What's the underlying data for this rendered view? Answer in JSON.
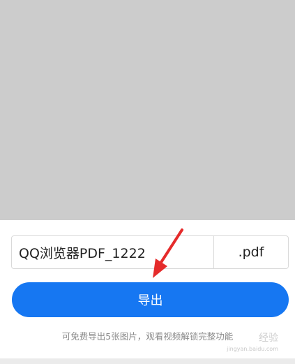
{
  "export_form": {
    "filename_value": "QQ浏览器PDF_1222",
    "extension": ".pdf",
    "export_label": "导出",
    "hint": "可免费导出5张图片，观看视频解锁完整功能"
  },
  "watermark": {
    "text": "经验",
    "url": "jingyan.baidu.com"
  },
  "colors": {
    "preview_bg": "#cccccc",
    "accent": "#1677f2",
    "arrow": "#e52b2b"
  }
}
